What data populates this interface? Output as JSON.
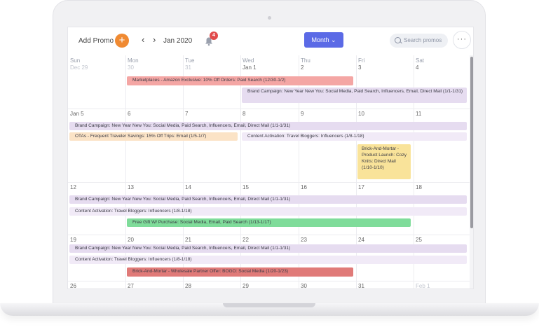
{
  "toolbar": {
    "add_promo_label": "Add Promo",
    "add_button_glyph": "+",
    "prev_glyph": "‹",
    "next_glyph": "›",
    "month_label": "Jan 2020",
    "notification_count": "4",
    "view_button_label": "Month ⌄",
    "search_placeholder": "Search promos",
    "more_glyph": "···"
  },
  "calendar": {
    "day_names": [
      "Sun",
      "Mon",
      "Tue",
      "Wed",
      "Thu",
      "Fri",
      "Sat"
    ],
    "weeks": [
      [
        "Dec 29",
        "30",
        "31",
        "Jan 1",
        "2",
        "3",
        "4"
      ],
      [
        "Jan 5",
        "6",
        "7",
        "8",
        "9",
        "10",
        "11"
      ],
      [
        "12",
        "13",
        "14",
        "15",
        "16",
        "17",
        "18"
      ],
      [
        "19",
        "20",
        "21",
        "22",
        "23",
        "24",
        "25"
      ],
      [
        "26",
        "27",
        "28",
        "29",
        "30",
        "31",
        "Feb 1"
      ]
    ],
    "events": [
      {
        "label": "Marketplaces - Amazon Exclusive: 10% Off Orders: Paid Search (12/30-1/2)",
        "color": "#f4a6a4"
      },
      {
        "label": "Brand Campaign: New Year New You: Social Media, Paid Search, Influencers, Email, Direct Mail (1/1-1/31)",
        "color": "#e6dcf0"
      },
      {
        "label": "Brand Campaign: New Year New You: Social Media, Paid Search, Influencers, Email, Direct Mail (1/1-1/31)",
        "color": "#e6dcf0"
      },
      {
        "label": "OTAs - Frequent Traveler Savings: 15% Off Trips: Email (1/5-1/7)",
        "color": "#fbe3c6"
      },
      {
        "label": "Content Activation: Travel Bloggers: Influencers (1/8-1/18)",
        "color": "#f1eaf7"
      },
      {
        "label": "Brick-And-Mortar - Product Launch: Cozy Knits: Direct Mail (1/10-1/10)",
        "color": "#f9e39a"
      },
      {
        "label": "Brand Campaign: New Year New You: Social Media, Paid Search, Influencers, Email, Direct Mail (1/1-1/31)",
        "color": "#e6dcf0"
      },
      {
        "label": "Content Activation: Travel Bloggers: Influencers (1/8-1/18)",
        "color": "#f1eaf7"
      },
      {
        "label": "Free Gift W/ Purchase: Social Media, Email, Paid Search (1/13-1/17)",
        "color": "#7fdc9a"
      },
      {
        "label": "Brand Campaign: New Year New You: Social Media, Paid Search, Influencers, Email, Direct Mail (1/1-1/31)",
        "color": "#e6dcf0"
      },
      {
        "label": "Content Activation: Travel Bloggers: Influencers (1/8-1/18)",
        "color": "#f1eaf7"
      },
      {
        "label": "Brick-And-Mortar - Wholesale Partner Offer: BOGO: Social Media (1/20-1/23)",
        "color": "#e07a78"
      }
    ]
  },
  "colors": {
    "accent": "#5b6ae6",
    "add_button": "#f08a32",
    "badge": "#e14b4b"
  }
}
